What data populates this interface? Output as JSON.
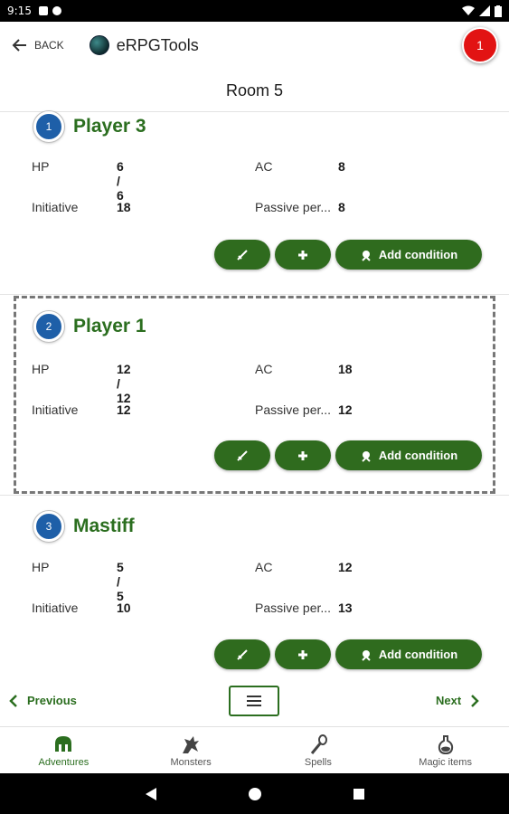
{
  "status": {
    "time": "9:15"
  },
  "appbar": {
    "back_label": "BACK",
    "app_title": "eRPGTools",
    "notification_count": "1"
  },
  "room": {
    "title": "Room 5"
  },
  "labels": {
    "hp": "HP",
    "ac": "AC",
    "initiative": "Initiative",
    "passive": "Passive per...",
    "add_condition": "Add condition"
  },
  "combatants": [
    {
      "order": "1",
      "name": "Player 3",
      "hp": "6 / 6",
      "ac": "8",
      "initiative": "18",
      "passive": "8"
    },
    {
      "order": "2",
      "name": "Player 1",
      "hp": "12 / 12",
      "ac": "18",
      "initiative": "12",
      "passive": "12",
      "active": true
    },
    {
      "order": "3",
      "name": "Mastiff",
      "hp": "5 / 5",
      "ac": "12",
      "initiative": "10",
      "passive": "13"
    }
  ],
  "pager": {
    "previous": "Previous",
    "next": "Next"
  },
  "bottom_nav": [
    {
      "label": "Adventures",
      "icon": "helmet-icon",
      "active": true
    },
    {
      "label": "Monsters",
      "icon": "dragon-icon"
    },
    {
      "label": "Spells",
      "icon": "wand-icon"
    },
    {
      "label": "Magic items",
      "icon": "potion-icon"
    }
  ],
  "colors": {
    "primary": "#2f6b1e",
    "badge": "#1e5fa8",
    "notification": "#e21313"
  }
}
